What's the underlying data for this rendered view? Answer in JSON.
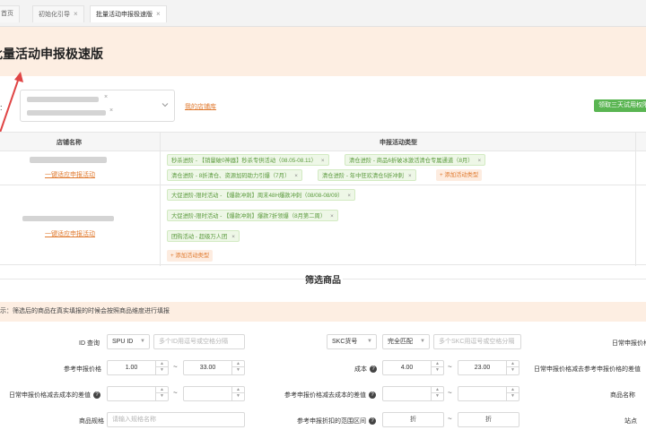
{
  "tabs": [
    {
      "label": "首页",
      "closable": false
    },
    {
      "label": "初始化引导",
      "closable": true
    },
    {
      "label": "批量活动申报极速版",
      "closable": true,
      "active": true
    }
  ],
  "page": {
    "title": "批量活动申报极速版"
  },
  "filter": {
    "link_manage": "我的店铺库",
    "green_button": "领取三天试用权限"
  },
  "table": {
    "headers": [
      "店铺名称",
      "申报活动类型"
    ],
    "rows": [
      {
        "action": "一键适应申报活动",
        "tags": [
          "秒杀进阶 - 【销量破0神器】秒杀专供活动（08.05-08.11）",
          "清仓进阶 - 商品6折破冰激活清仓专属通道（8月）",
          "清仓进阶 - 8折清仓、资源加码助力引爆（7月）",
          "清仓进阶 - 年中狂欢清仓5折冲刺"
        ],
        "add": "+ 添加活动类型"
      },
      {
        "action": "一键适应申报活动",
        "tags": [
          "大促进阶-限时活动 - 【爆款冲刺】周末48H爆款冲刺（08/08-08/09）",
          "大促进阶-限时活动 - 【爆款冲刺】爆款7折领爆（8月第二周）",
          "团购活动 - 超级万人团"
        ],
        "add": "+ 添加活动类型"
      }
    ],
    "tag_close": "×"
  },
  "section": {
    "title": "筛选商品",
    "notice": "示：筛选后的商品在真实填报的时候会按照商品维度进行填报"
  },
  "form": {
    "id_query_label": "ID 查询",
    "id_type": "SPU ID",
    "id_placeholder": "多个ID用逗号或空格分隔",
    "skc_type": "SKC货号",
    "match_type": "完全匹配",
    "skc_placeholder": "多个SKC用逗号或空格分隔",
    "daily_price_label": "日常申报价格",
    "ref_price_label": "参考申报价格",
    "ref_price_min": "1.00",
    "ref_price_max": "33.00",
    "cost_label": "成本",
    "cost_min": "4.00",
    "cost_max": "23.00",
    "daily_minus_ref_label": "日常申报价格减去参考申报价格的差值",
    "daily_minus_cost_label": "日常申报价格减去成本的差值",
    "ref_minus_cost_label": "参考申报价格减去成本的差值",
    "product_name_label": "商品名称",
    "spec_label": "商品规格",
    "spec_placeholder": "请输入规格名称",
    "discount_label": "参考申报折扣的范围区间",
    "discount_unit": "折",
    "site_label": "站点",
    "tilde": "~",
    "help": "?"
  },
  "colors": {
    "accent": "#e07a2f",
    "header_bg": "#fdeee2",
    "green": "#5ab552",
    "tag_green": "#5a9a3c",
    "arrow": "#e04545"
  }
}
